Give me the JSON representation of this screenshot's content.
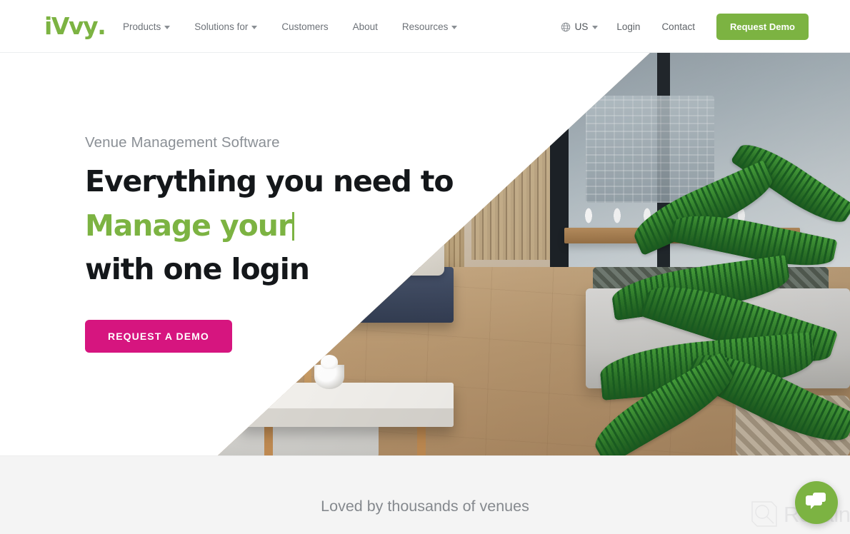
{
  "header": {
    "logo": {
      "text": "iVvy",
      "dot": ".",
      "alt": "iVvy logo"
    },
    "nav": [
      {
        "label": "Products",
        "has_caret": true
      },
      {
        "label": "Solutions for",
        "has_caret": true
      },
      {
        "label": "Customers",
        "has_caret": false
      },
      {
        "label": "About",
        "has_caret": false
      },
      {
        "label": "Resources",
        "has_caret": true
      }
    ],
    "locale": {
      "label": "US",
      "icon": "globe-icon"
    },
    "login_label": "Login",
    "contact_label": "Contact",
    "demo_button_label": "Request Demo",
    "demo_button_color": "#7cb342"
  },
  "hero": {
    "eyebrow": "Venue Management Software",
    "headline_line1": "Everything you need to",
    "headline_line2": "Manage your",
    "headline_line3": "with one login",
    "headline_accent_color": "#7cb342",
    "cta_label": "REQUEST A DEMO",
    "cta_color": "#d6157f",
    "image_alt": "Outdoor venue lounge with sofas, timber slat wall, stone coffee tables and palm plants"
  },
  "band": {
    "title": "Loved by thousands of venues"
  },
  "watermark": {
    "text": "Revain",
    "icon": "revain-logo-icon"
  },
  "chat": {
    "icon": "chat-bubble-icon",
    "color": "#7cb342",
    "label": "Open chat"
  }
}
